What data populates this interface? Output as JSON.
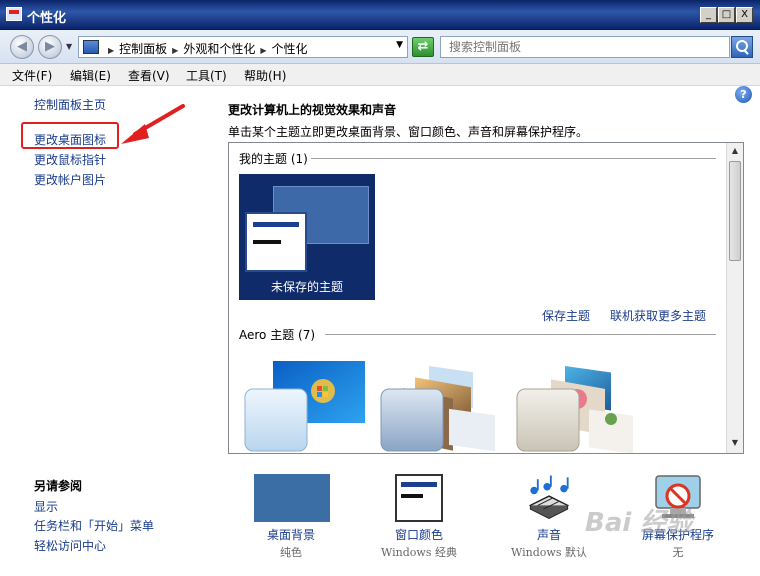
{
  "window": {
    "title": "个性化",
    "minimize": "_",
    "maximize": "□",
    "close": "X"
  },
  "address": {
    "crumbs": [
      "控制面板",
      "外观和个性化",
      "个性化"
    ],
    "search_placeholder": "搜索控制面板"
  },
  "menu": [
    "文件(F)",
    "编辑(E)",
    "查看(V)",
    "工具(T)",
    "帮助(H)"
  ],
  "sidebar": {
    "home": "控制面板主页",
    "links": [
      "更改桌面图标",
      "更改鼠标指针",
      "更改帐户图片"
    ],
    "see_also_title": "另请参阅",
    "see_also": [
      "显示",
      "任务栏和「开始」菜单",
      "轻松访问中心"
    ]
  },
  "main": {
    "heading": "更改计算机上的视觉效果和声音",
    "subheading": "单击某个主题立即更改桌面背景、窗口颜色、声音和屏幕保护程序。",
    "my_themes_label": "我的主题 (1)",
    "unsaved_theme": "未保存的主题",
    "save_theme": "保存主题",
    "get_more_themes": "联机获取更多主题",
    "aero_themes_label": "Aero 主题 (7)"
  },
  "bottom": [
    {
      "label": "桌面背景",
      "sub": "纯色",
      "icon": "desktop-background-icon"
    },
    {
      "label": "窗口颜色",
      "sub": "Windows 经典",
      "icon": "window-color-icon"
    },
    {
      "label": "声音",
      "sub": "Windows 默认",
      "icon": "sound-icon"
    },
    {
      "label": "屏幕保护程序",
      "sub": "无",
      "icon": "screensaver-icon"
    }
  ],
  "watermark": "Bai 经验",
  "colors": {
    "titlebar": "#0a246a",
    "link": "#1a3c8c",
    "highlight": "#e02020",
    "desktop_swatch": "#3a6ea5"
  }
}
